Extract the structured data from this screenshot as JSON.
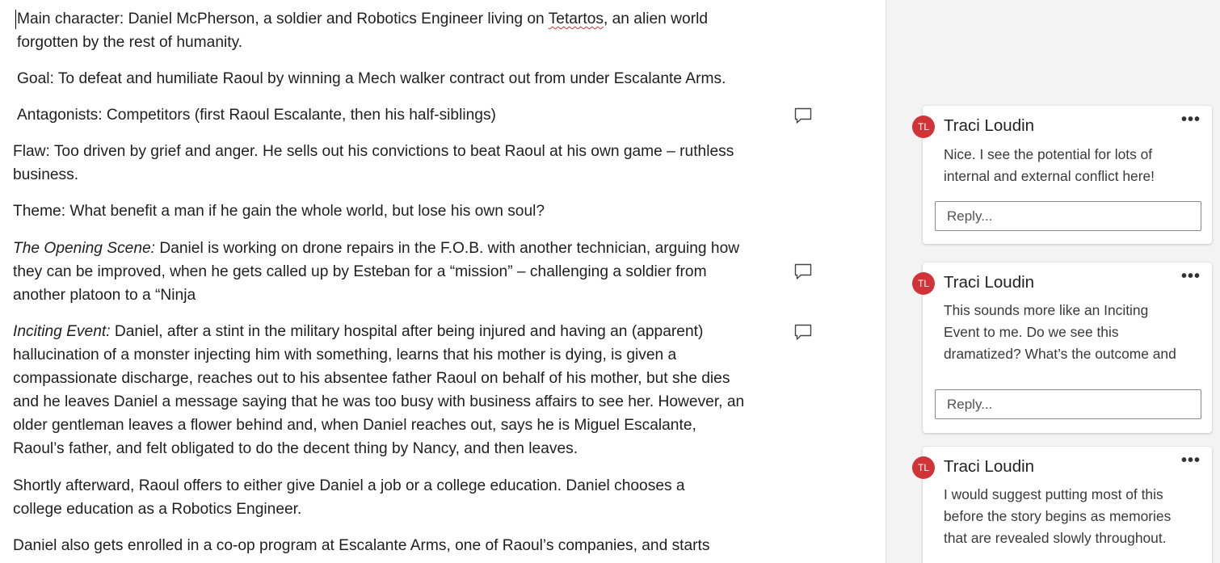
{
  "document": {
    "paragraphs": [
      {
        "label": "",
        "lines": [
          {
            "pre": "Main character: Daniel McPherson, a soldier and Robotics Engineer living on ",
            "spell": "Tetartos",
            "post": ", an alien world"
          },
          {
            "pre": "forgotten by the rest of humanity.",
            "spell": "",
            "post": ""
          }
        ]
      },
      {
        "label": "",
        "lines": [
          {
            "pre": "Goal: To defeat and humiliate Raoul by winning a Mech walker contract out from under Escalante Arms.",
            "spell": "",
            "post": ""
          }
        ]
      },
      {
        "label": "",
        "lines": [
          {
            "pre": "Antagonists: Competitors (first Raoul Escalante, then his half-siblings)",
            "spell": "",
            "post": ""
          }
        ]
      },
      {
        "label": "",
        "lines": [
          {
            "pre": "Flaw: Too driven by grief and anger. He sells out his convictions to beat Raoul at his own game – ruthless",
            "spell": "",
            "post": ""
          },
          {
            "pre": "business.",
            "spell": "",
            "post": ""
          }
        ]
      },
      {
        "label": "",
        "lines": [
          {
            "pre": "Theme: What benefit a man if he gain the whole world, but lose his own soul?",
            "spell": "",
            "post": ""
          }
        ]
      },
      {
        "label": "The Opening Scene:",
        "lines": [
          {
            "pre": " Daniel is working on drone repairs in the F.O.B. with another technician, arguing how",
            "spell": "",
            "post": ""
          },
          {
            "pre": "they can be improved, when he gets called up by Esteban for a “mission” – challenging a soldier from",
            "spell": "",
            "post": ""
          },
          {
            "pre": "another platoon to a “Ninja",
            "spell": "",
            "post": ""
          }
        ]
      },
      {
        "label": "Inciting Event:",
        "lines": [
          {
            "pre": " Daniel, after a stint in the military hospital after being injured and having an (apparent)",
            "spell": "",
            "post": ""
          },
          {
            "pre": "hallucination of a monster injecting him with something, learns that his mother is dying, is given a",
            "spell": "",
            "post": ""
          },
          {
            "pre": "compassionate discharge, reaches out to his absentee father Raoul on behalf of his mother, but she dies",
            "spell": "",
            "post": ""
          },
          {
            "pre": "and he leaves Daniel a message saying that he was too busy with business affairs to see her. However, an",
            "spell": "",
            "post": ""
          },
          {
            "pre": "older gentleman leaves a flower behind and, when Daniel reaches out, says he is Miguel Escalante,",
            "spell": "",
            "post": ""
          },
          {
            "pre": "Raoul’s father, and felt obligated to do the decent thing by Nancy, and then leaves.",
            "spell": "",
            "post": ""
          }
        ]
      },
      {
        "label": "",
        "lines": [
          {
            "pre": "Shortly afterward, Raoul offers to either give Daniel a job or a college education. Daniel chooses a",
            "spell": "",
            "post": ""
          },
          {
            "pre": "college education as a Robotics Engineer.",
            "spell": "",
            "post": ""
          }
        ]
      },
      {
        "label": "",
        "lines": [
          {
            "pre": "Daniel also gets enrolled in a co-op program at Escalante Arms, one of Raoul’s companies, and starts",
            "spell": "",
            "post": ""
          }
        ]
      }
    ]
  },
  "comments": [
    {
      "initials": "TL",
      "author": "Traci Loudin",
      "more": "•••",
      "lines": [
        "Nice. I see the potential for lots of",
        "internal and external conflict here!"
      ],
      "reply_placeholder": "Reply..."
    },
    {
      "initials": "TL",
      "author": "Traci Loudin",
      "more": "•••",
      "lines": [
        "This sounds more like an Inciting",
        "Event to me. Do we see this",
        "dramatized? What’s the outcome and"
      ],
      "reply_placeholder": "Reply..."
    },
    {
      "initials": "TL",
      "author": "Traci Loudin",
      "more": "•••",
      "lines": [
        "I would suggest putting most of this",
        "before the story begins as memories",
        "that are revealed slowly throughout."
      ],
      "reply_placeholder": ""
    }
  ],
  "colors": {
    "avatar": "#d13438",
    "pane_background": "#f3f3f3",
    "spellcheck_underline": "#d13438"
  }
}
